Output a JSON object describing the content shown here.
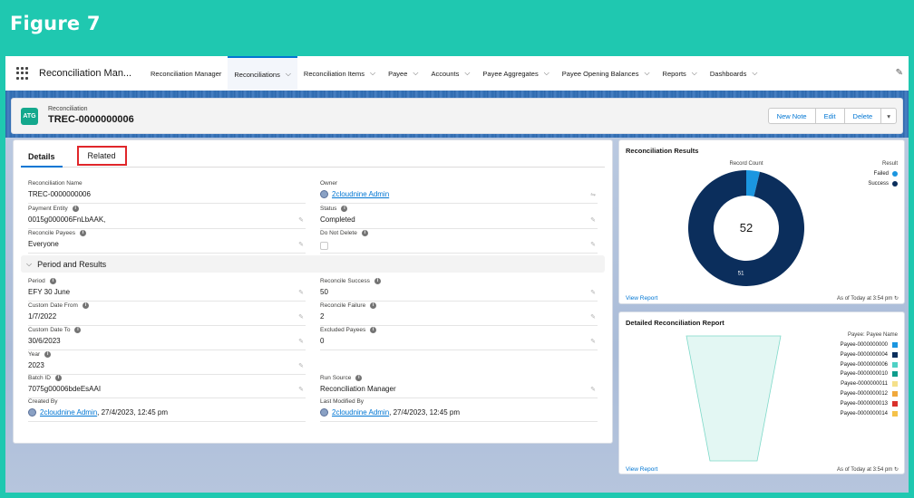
{
  "figure_title": "Figure 7",
  "app_name": "Reconciliation Man...",
  "nav_tabs": [
    {
      "label": "Reconciliation Manager",
      "has_menu": false,
      "active": false
    },
    {
      "label": "Reconciliations",
      "has_menu": true,
      "active": true
    },
    {
      "label": "Reconciliation Items",
      "has_menu": true,
      "active": false
    },
    {
      "label": "Payee",
      "has_menu": true,
      "active": false
    },
    {
      "label": "Accounts",
      "has_menu": true,
      "active": false
    },
    {
      "label": "Payee Aggregates",
      "has_menu": true,
      "active": false
    },
    {
      "label": "Payee Opening Balances",
      "has_menu": true,
      "active": false
    },
    {
      "label": "Reports",
      "has_menu": true,
      "active": false
    },
    {
      "label": "Dashboards",
      "has_menu": true,
      "active": false
    }
  ],
  "record": {
    "icon_text": "ATG",
    "type": "Reconciliation",
    "name": "TREC-0000000006",
    "actions": [
      "New Note",
      "Edit",
      "Delete"
    ]
  },
  "tabs": {
    "details": "Details",
    "related": "Related"
  },
  "fields": {
    "recon_name": {
      "label": "Reconciliation Name",
      "value": "TREC-0000000006"
    },
    "owner": {
      "label": "Owner",
      "value": "2cloudnine Admin"
    },
    "payment_entity": {
      "label": "Payment Entity",
      "value": "0015g000006FnLbAAK,"
    },
    "status": {
      "label": "Status",
      "value": "Completed"
    },
    "reconcile_payees": {
      "label": "Reconcile Payees",
      "value": "Everyone"
    },
    "do_not_delete": {
      "label": "Do Not Delete",
      "value": ""
    },
    "section_title": "Period and Results",
    "period": {
      "label": "Period",
      "value": "EFY 30 June"
    },
    "reconcile_success": {
      "label": "Reconcile Success",
      "value": "50"
    },
    "custom_from": {
      "label": "Custom Date From",
      "value": "1/7/2022"
    },
    "reconcile_failure": {
      "label": "Reconcile Failure",
      "value": "2"
    },
    "custom_to": {
      "label": "Custom Date To",
      "value": "30/6/2023"
    },
    "excluded_payees": {
      "label": "Excluded Payees",
      "value": "0"
    },
    "year": {
      "label": "Year",
      "value": "2023"
    },
    "batch_id": {
      "label": "Batch ID",
      "value": "7075g00006bdeEsAAI"
    },
    "run_source": {
      "label": "Run Source",
      "value": "Reconciliation Manager"
    },
    "created_by": {
      "label": "Created By",
      "user": "2cloudnine Admin",
      "date": ", 27/4/2023, 12:45 pm"
    },
    "last_modified_by": {
      "label": "Last Modified By",
      "user": "2cloudnine Admin",
      "date": ", 27/4/2023, 12:45 pm"
    }
  },
  "results_card": {
    "title": "Reconciliation Results",
    "chart_label": "Record Count",
    "legend_title": "Result",
    "view_report": "View Report",
    "as_of": "As of Today at 3:54 pm"
  },
  "detail_card": {
    "title": "Detailed Reconciliation Report",
    "legend_title": "Payee: Payee Name",
    "view_report": "View Report",
    "as_of": "As of Today at 3:54 pm"
  },
  "colors": {
    "accent": "#0176d3",
    "frame": "#1fc8b0",
    "success": "#0b2e5c",
    "failed": "#1b96e0",
    "funnel": "#e3f7f3"
  },
  "chart_data": [
    {
      "type": "pie",
      "title": "Reconciliation Results",
      "center_total": "52",
      "categories": [
        "Failed",
        "Success"
      ],
      "values": [
        2,
        51
      ],
      "data_labels": [
        "",
        "51"
      ],
      "colors": [
        "#1b96e0",
        "#0b2e5c"
      ],
      "legend": "top-right"
    },
    {
      "type": "bar",
      "title": "Detailed Reconciliation Report",
      "categories": [
        "Payee-0000000000",
        "Payee-0000000004",
        "Payee-0000000006",
        "Payee-0000000010",
        "Payee-0000000011",
        "Payee-0000000012",
        "Payee-0000000013",
        "Payee-0000000014"
      ],
      "colors": [
        "#1b96e0",
        "#0b2e5c",
        "#4fd1c5",
        "#0e9c8c",
        "#f5e08a",
        "#f0a83c",
        "#d9302b",
        "#f5c24a"
      ],
      "legend": "right"
    }
  ]
}
